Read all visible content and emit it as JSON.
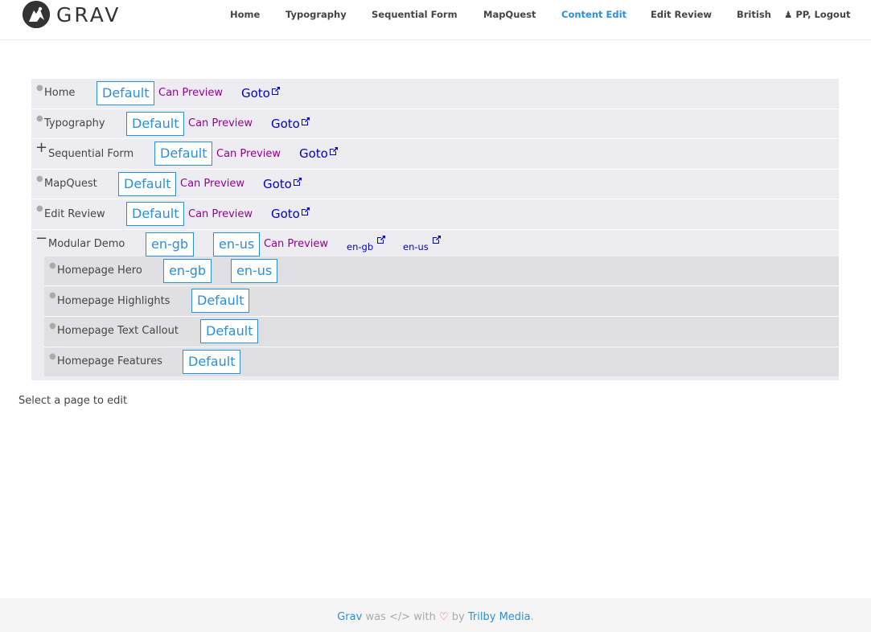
{
  "brand": {
    "logo_text": "GRAV"
  },
  "nav": {
    "items": [
      {
        "label": "Home"
      },
      {
        "label": "Typography"
      },
      {
        "label": "Sequential Form"
      },
      {
        "label": "MapQuest"
      },
      {
        "label": "Content Edit",
        "active": true
      },
      {
        "label": "Edit Review"
      },
      {
        "label": "British"
      }
    ],
    "user_label": "PP,",
    "logout_label": "Logout",
    "accent_color": "#2b8fde"
  },
  "tree": {
    "rows": [
      {
        "title": "Home",
        "toggle": "bullet",
        "lang": "Default",
        "preview": "Can Preview",
        "goto": "Goto"
      },
      {
        "title": "Typography",
        "toggle": "bullet",
        "lang": "Default",
        "preview": "Can Preview",
        "goto": "Goto"
      },
      {
        "title": "Sequential Form",
        "toggle": "+",
        "lang": "Default",
        "preview": "Can Preview",
        "goto": "Goto"
      },
      {
        "title": "MapQuest",
        "toggle": "bullet",
        "lang": "Default",
        "preview": "Can Preview",
        "goto": "Goto"
      },
      {
        "title": "Edit Review",
        "toggle": "bullet",
        "lang": "Default",
        "preview": "Can Preview",
        "goto": "Goto"
      },
      {
        "title": "Modular Demo",
        "toggle": "−",
        "lang1": "en-gb",
        "lang2": "en-us",
        "preview": "Can Preview",
        "goto1": "en-gb",
        "goto2": "en-us"
      }
    ],
    "children": [
      {
        "title": "Homepage Hero",
        "lang1": "en-gb",
        "lang2": "en-us"
      },
      {
        "title": "Homepage Highlights",
        "lang": "Default"
      },
      {
        "title": "Homepage Text Callout",
        "lang": "Default"
      },
      {
        "title": "Homepage Features",
        "lang": "Default"
      }
    ]
  },
  "hint": "Select a page to edit",
  "footer": {
    "grav": "Grav",
    "was": "was",
    "with": "with",
    "by": "by",
    "trilby": "Trilby Media",
    "period": "."
  }
}
